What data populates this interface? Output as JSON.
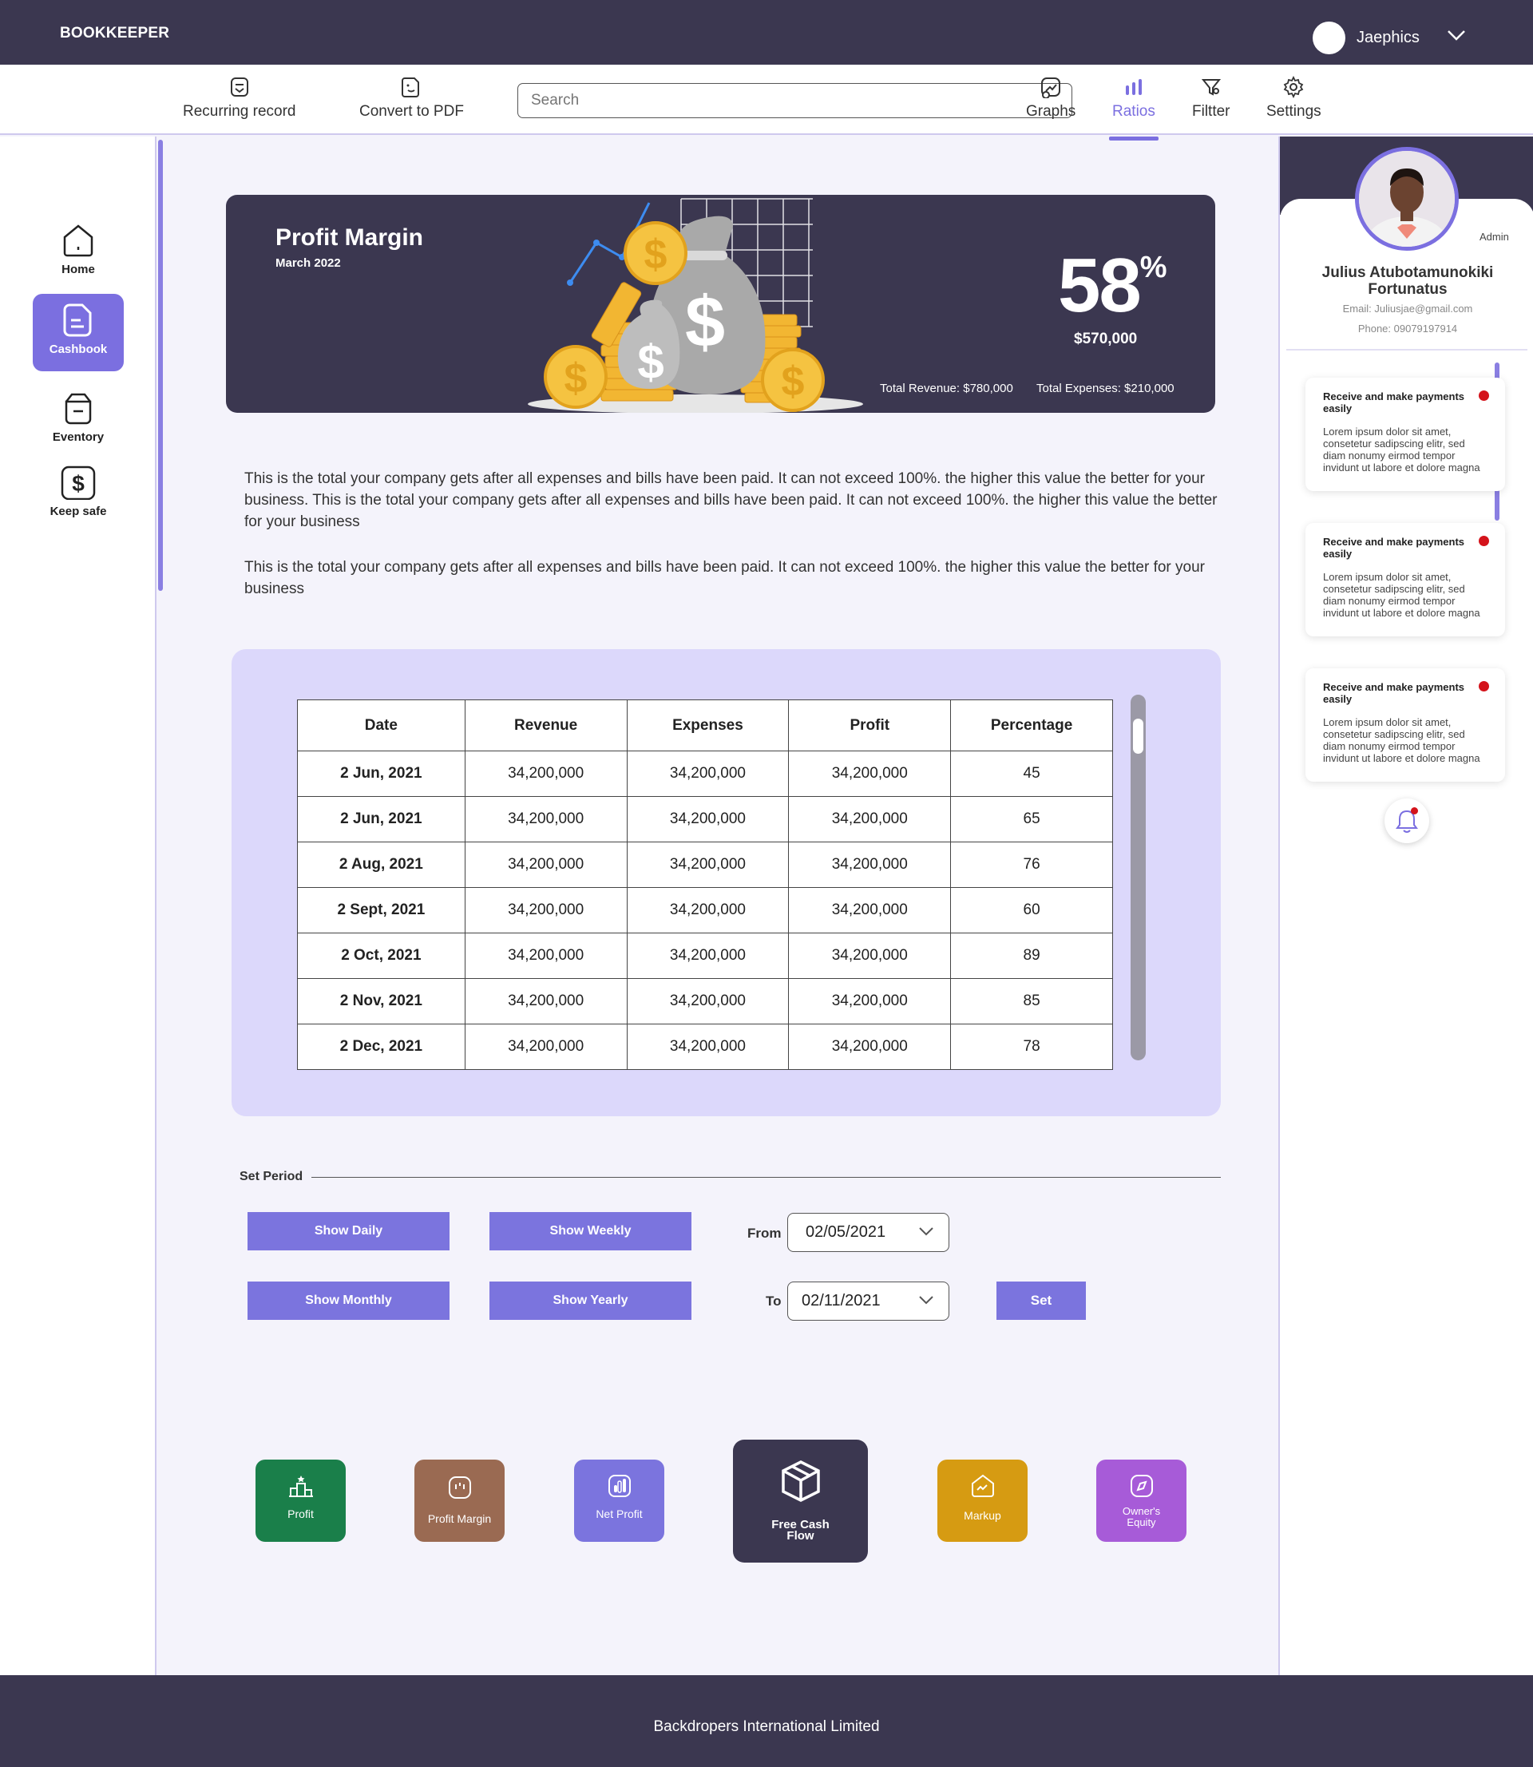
{
  "app": {
    "brand": "BOOKKEEPER",
    "user_name": "Jaephics"
  },
  "toolbar": {
    "recurring": "Recurring record",
    "convert": "Convert to PDF",
    "search_placeholder": "Search",
    "graphs": "Graphs",
    "ratios": "Ratios",
    "filter": "Filtter",
    "settings": "Settings"
  },
  "sidebar": {
    "items": [
      {
        "label": "Home",
        "icon": "home-icon"
      },
      {
        "label": "Cashbook",
        "icon": "document-icon"
      },
      {
        "label": "Eventory",
        "icon": "box-icon"
      },
      {
        "label": "Keep safe",
        "icon": "dollar-icon"
      }
    ]
  },
  "banner": {
    "title": "Profit Margin",
    "subtitle": "March 2022",
    "percent": "58",
    "percent_symbol": "%",
    "amount": "$570,000",
    "total_revenue": "Total Revenue: $780,000",
    "total_expenses": "Total Expenses: $210,000"
  },
  "description": {
    "p1": "This is the total your company gets after all expenses and bills have been paid. It can not exceed 100%. the higher this value the better for your business. This is the total your company gets after all expenses and bills have been paid. It can not exceed 100%. the higher this value the better for your business",
    "p2": "This is the total your company gets after all expenses and bills have been paid. It can not exceed 100%. the higher this value the better for your business"
  },
  "table": {
    "headers": [
      "Date",
      "Revenue",
      "Expenses",
      "Profit",
      "Percentage"
    ],
    "rows": [
      [
        "2 Jun, 2021",
        "34,200,000",
        "34,200,000",
        "34,200,000",
        "45"
      ],
      [
        "2 Jun, 2021",
        "34,200,000",
        "34,200,000",
        "34,200,000",
        "65"
      ],
      [
        "2 Aug, 2021",
        "34,200,000",
        "34,200,000",
        "34,200,000",
        "76"
      ],
      [
        "2 Sept, 2021",
        "34,200,000",
        "34,200,000",
        "34,200,000",
        "60"
      ],
      [
        "2 Oct, 2021",
        "34,200,000",
        "34,200,000",
        "34,200,000",
        "89"
      ],
      [
        "2 Nov, 2021",
        "34,200,000",
        "34,200,000",
        "34,200,000",
        "85"
      ],
      [
        "2 Dec, 2021",
        "34,200,000",
        "34,200,000",
        "34,200,000",
        "78"
      ]
    ]
  },
  "period": {
    "label": "Set Period",
    "show_daily": "Show Daily",
    "show_weekly": "Show Weekly",
    "show_monthly": "Show Monthly",
    "show_yearly": "Show Yearly",
    "from_label": "From",
    "from_value": "02/05/2021",
    "to_label": "To",
    "to_value": "02/11/2021",
    "set": "Set"
  },
  "ratios": {
    "profit": "Profit",
    "profit_margin": "Profit Margin",
    "net_profit": "Net Profit",
    "free_cash_flow_1": "Free Cash",
    "free_cash_flow_2": "Flow",
    "markup": "Markup",
    "owners_equity_1": "Owner's",
    "owners_equity_2": "Equity"
  },
  "colors": {
    "dark": "#3b3750",
    "accent": "#7b6fe0",
    "profit_tile": "#1a7f4a",
    "profit_margin_tile": "#9a6a52",
    "net_profit_tile": "#7b74de",
    "markup_tile": "#d69b12",
    "owners_equity_tile": "#a75bd8"
  },
  "profile": {
    "role": "Admin",
    "name_line1": "Julius Atubotamunokiki",
    "name_line2": "Fortunatus",
    "email": "Email: Juliusjae@gmail.com",
    "phone": "Phone: 09079197914"
  },
  "notifications": [
    {
      "title": "Receive and make payments easily",
      "body": "Lorem ipsum dolor sit amet, consetetur sadipscing elitr, sed diam nonumy eirmod tempor invidunt ut labore et dolore magna"
    },
    {
      "title": "Receive and make payments easily",
      "body": "Lorem ipsum dolor sit amet, consetetur sadipscing elitr, sed diam nonumy eirmod tempor invidunt ut labore et dolore magna"
    },
    {
      "title": "Receive and make payments easily",
      "body": "Lorem ipsum dolor sit amet, consetetur sadipscing elitr, sed diam nonumy eirmod tempor invidunt ut labore et dolore magna"
    }
  ],
  "footer": {
    "text": "Backdropers International Limited"
  }
}
